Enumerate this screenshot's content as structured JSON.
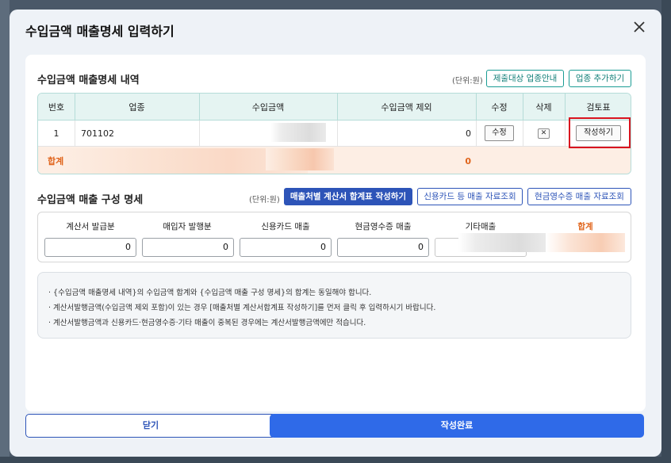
{
  "modal": {
    "title": "수입금액 매출명세 입력하기",
    "close_label": "×"
  },
  "section1": {
    "title": "수입금액 매출명세 내역",
    "unit": "(단위:원)",
    "btn_guide": "제출대상 업종안내",
    "btn_add": "업종 추가하기",
    "headers": [
      "번호",
      "업종",
      "수입금액",
      "수입금액 제외",
      "수정",
      "삭제",
      "검토표"
    ],
    "row": {
      "no": "1",
      "industry": "701102",
      "income_excluded": "0",
      "edit_label": "수정",
      "delete_label": "✕",
      "review_label": "작성하기"
    },
    "sum": {
      "label": "합계",
      "excluded_total": "0"
    }
  },
  "section2": {
    "title": "수입금액 매출 구성 명세",
    "unit": "(단위:원)",
    "btn_summary": "매출처별 계산서 합계표 작성하기",
    "btn_card": "신용카드 등 매출 자료조회",
    "btn_cash": "현금영수증 매출 자료조회",
    "labels": [
      "계산서 발급분",
      "매입자 발행분",
      "신용카드 매출",
      "현금영수증 매출",
      "기타매출",
      "합계"
    ],
    "values": [
      "0",
      "0",
      "0",
      "0"
    ]
  },
  "notes": [
    "· {수입금액 매출명세 내역}의 수입금액 합계와 {수입금액 매출 구성 명세}의 합계는 동일해야 합니다.",
    "· 계산서발행금액(수입금액 제외 포함)이 있는 경우 [매출처별 계산서합계표 작성하기]를 먼저 클릭 후 입력하시기 바랍니다.",
    "· 계산서발행금액과 신용카드·현금영수증·기타 매출이 중복된 경우에는 계산서발행금액에만 적습니다."
  ],
  "footer": {
    "close_label": "닫기",
    "done_label": "작성완료"
  },
  "colors": {
    "accent_teal": "#1a9c94",
    "accent_blue": "#2d54b8",
    "primary_button": "#2f6ae8",
    "sum_orange": "#e0641b",
    "highlight_red": "#d9141f"
  }
}
